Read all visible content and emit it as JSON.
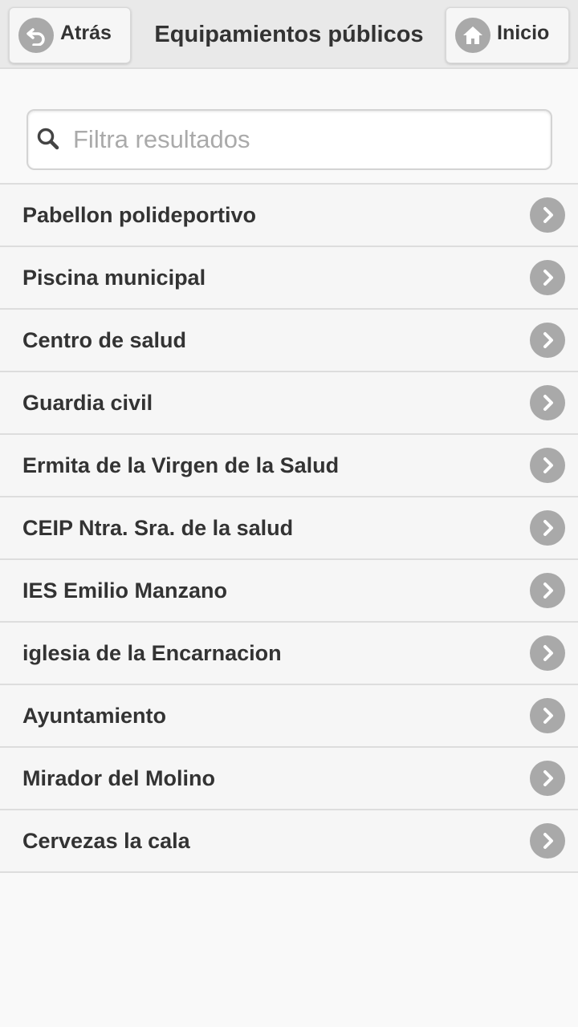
{
  "header": {
    "back_label": "Atrás",
    "title": "Equipamientos públicos",
    "home_label": "Inicio"
  },
  "search": {
    "placeholder": "Filtra resultados",
    "value": ""
  },
  "items": [
    {
      "label": "Pabellon polideportivo"
    },
    {
      "label": "Piscina municipal"
    },
    {
      "label": "Centro de salud"
    },
    {
      "label": "Guardia civil"
    },
    {
      "label": "Ermita de la Virgen de la Salud"
    },
    {
      "label": "CEIP Ntra. Sra. de la salud"
    },
    {
      "label": "IES Emilio Manzano"
    },
    {
      "label": "iglesia de la Encarnacion"
    },
    {
      "label": "Ayuntamiento"
    },
    {
      "label": "Mirador del Molino"
    },
    {
      "label": "Cervezas la cala"
    }
  ],
  "icons": {
    "back": "undo-arrow-icon",
    "home": "home-icon",
    "search": "search-icon",
    "row_action": "chevron-right-icon"
  },
  "colors": {
    "icon_disc": "#a9a9a9",
    "header_bg": "#e9e9e9",
    "row_bg": "#f6f6f6",
    "text": "#333333"
  }
}
